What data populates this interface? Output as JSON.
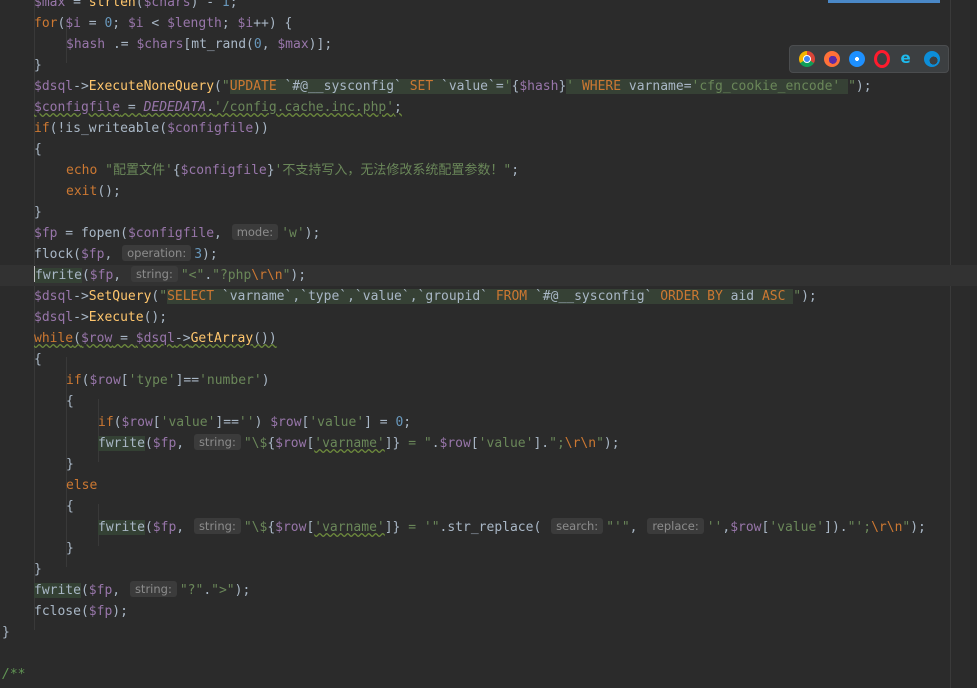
{
  "editor": {
    "lines": [
      {
        "id": "l0",
        "indent": 1,
        "segments": [
          [
            "var",
            "$max"
          ],
          [
            "def",
            " = "
          ],
          [
            "fn",
            "strlen"
          ],
          [
            "def",
            "("
          ],
          [
            "var",
            "$chars"
          ],
          [
            "def",
            ") - "
          ],
          [
            "num",
            "1"
          ],
          [
            "def",
            ";"
          ]
        ]
      },
      {
        "id": "l1",
        "indent": 1,
        "segments": [
          [
            "kw",
            "for"
          ],
          [
            "def",
            "("
          ],
          [
            "var",
            "$i"
          ],
          [
            "def",
            " = "
          ],
          [
            "num",
            "0"
          ],
          [
            "def",
            "; "
          ],
          [
            "var",
            "$i"
          ],
          [
            "def",
            " < "
          ],
          [
            "var",
            "$length"
          ],
          [
            "def",
            "; "
          ],
          [
            "var",
            "$i"
          ],
          [
            "def",
            "++) {"
          ]
        ]
      },
      {
        "id": "l2",
        "indent": 2,
        "segments": [
          [
            "var",
            "$hash"
          ],
          [
            "def",
            " .= "
          ],
          [
            "var",
            "$chars"
          ],
          [
            "def",
            "[mt_rand("
          ],
          [
            "num",
            "0"
          ],
          [
            "def",
            ", "
          ],
          [
            "var",
            "$max"
          ],
          [
            "def",
            ")];"
          ]
        ]
      },
      {
        "id": "l3",
        "indent": 1,
        "segments": [
          [
            "def",
            "}"
          ]
        ]
      },
      {
        "id": "l4",
        "indent": 1,
        "segments": [
          [
            "var",
            "$dsql"
          ],
          [
            "def",
            "->"
          ],
          [
            "fn",
            "ExecuteNoneQuery"
          ],
          [
            "def",
            "("
          ],
          [
            "str",
            "\""
          ],
          [
            "sqlkw",
            "UPDATE"
          ],
          [
            "sqlbgdef",
            " `#@__sysconfig` "
          ],
          [
            "sqlkw",
            "SET"
          ],
          [
            "sqlbgdef",
            " `value`="
          ],
          [
            "sqlbgstr",
            "'"
          ],
          [
            "def",
            "{"
          ],
          [
            "var",
            "$hash"
          ],
          [
            "def",
            "}"
          ],
          [
            "sqlbgstr",
            "' "
          ],
          [
            "sqlkw",
            "WHERE"
          ],
          [
            "sqlbgdef",
            " varname="
          ],
          [
            "sqlbgstr",
            "'cfg_cookie_encode'"
          ],
          [
            "sqlbgdef",
            " "
          ],
          [
            "str",
            "\""
          ],
          [
            "def",
            ");"
          ]
        ]
      },
      {
        "id": "l5",
        "indent": 1,
        "segments": [
          [
            "var",
            "$configfile"
          ],
          [
            "def",
            " = "
          ],
          [
            "const",
            "DEDEDATA"
          ],
          [
            "def",
            "."
          ],
          [
            "str",
            "'/config.cache.inc.php'"
          ],
          [
            "def",
            ";"
          ]
        ],
        "underline": true
      },
      {
        "id": "l6",
        "indent": 1,
        "segments": [
          [
            "kw",
            "if"
          ],
          [
            "def",
            "(!is_writeable("
          ],
          [
            "var",
            "$configfile"
          ],
          [
            "def",
            "))"
          ]
        ]
      },
      {
        "id": "l7",
        "indent": 1,
        "segments": [
          [
            "def",
            "{"
          ]
        ]
      },
      {
        "id": "l8",
        "indent": 2,
        "segments": [
          [
            "kw",
            "echo"
          ],
          [
            "def",
            " "
          ],
          [
            "str",
            "\"配置文件'"
          ],
          [
            "def",
            "{"
          ],
          [
            "var",
            "$configfile"
          ],
          [
            "def",
            "}"
          ],
          [
            "str",
            "'不支持写入，无法修改系统配置参数！\""
          ],
          [
            "def",
            ";"
          ]
        ]
      },
      {
        "id": "l9",
        "indent": 2,
        "segments": [
          [
            "kw",
            "exit"
          ],
          [
            "def",
            "();"
          ]
        ]
      },
      {
        "id": "l10",
        "indent": 1,
        "segments": [
          [
            "def",
            "}"
          ]
        ]
      },
      {
        "id": "l11",
        "indent": 1,
        "segments": [
          [
            "var",
            "$fp"
          ],
          [
            "def",
            " = "
          ],
          [
            "def",
            "fopen("
          ],
          [
            "var",
            "$configfile"
          ],
          [
            "def",
            ", "
          ],
          [
            "hint",
            "mode:"
          ],
          [
            "str",
            "'w'"
          ],
          [
            "def",
            ");"
          ]
        ]
      },
      {
        "id": "l12",
        "indent": 1,
        "segments": [
          [
            "def",
            "flock("
          ],
          [
            "var",
            "$fp"
          ],
          [
            "def",
            ", "
          ],
          [
            "hint",
            "operation:"
          ],
          [
            "num",
            "3"
          ],
          [
            "def",
            ");"
          ]
        ]
      },
      {
        "id": "l13",
        "indent": 1,
        "caret": true,
        "segments": [
          [
            "hlw",
            "fwrite"
          ],
          [
            "def",
            "("
          ],
          [
            "var",
            "$fp"
          ],
          [
            "def",
            ", "
          ],
          [
            "hint",
            "string:"
          ],
          [
            "str",
            "\"<\""
          ],
          [
            "def",
            "."
          ],
          [
            "str",
            "\"?php"
          ],
          [
            "esc",
            "\\r\\n"
          ],
          [
            "str",
            "\""
          ],
          [
            "def",
            ");"
          ]
        ]
      },
      {
        "id": "l14",
        "indent": 1,
        "segments": [
          [
            "var",
            "$dsql"
          ],
          [
            "def",
            "->"
          ],
          [
            "fn",
            "SetQuery"
          ],
          [
            "def",
            "("
          ],
          [
            "str",
            "\""
          ],
          [
            "sqlkw",
            "SELECT"
          ],
          [
            "sqlbgdef",
            " `varname`,`type`,`value`,`groupid` "
          ],
          [
            "sqlkw",
            "FROM"
          ],
          [
            "sqlbgdef",
            " `#@__sysconfig` "
          ],
          [
            "sqlkw",
            "ORDER BY"
          ],
          [
            "sqlbgdef",
            " aid "
          ],
          [
            "sqlkw",
            "ASC"
          ],
          [
            "sqlbgdef",
            " "
          ],
          [
            "str",
            "\""
          ],
          [
            "def",
            ");"
          ]
        ]
      },
      {
        "id": "l15",
        "indent": 1,
        "segments": [
          [
            "var",
            "$dsql"
          ],
          [
            "def",
            "->"
          ],
          [
            "fn",
            "Execute"
          ],
          [
            "def",
            "();"
          ]
        ]
      },
      {
        "id": "l16",
        "indent": 1,
        "segments": [
          [
            "kwu",
            "while"
          ],
          [
            "defu",
            "("
          ],
          [
            "varu",
            "$row"
          ],
          [
            "defu",
            " = "
          ],
          [
            "varu",
            "$dsql"
          ],
          [
            "defu",
            "->"
          ],
          [
            "fnu",
            "GetArray"
          ],
          [
            "defu",
            "())"
          ]
        ]
      },
      {
        "id": "l17",
        "indent": 1,
        "segments": [
          [
            "def",
            "{"
          ]
        ]
      },
      {
        "id": "l18",
        "indent": 2,
        "segments": [
          [
            "kw",
            "if"
          ],
          [
            "def",
            "("
          ],
          [
            "var",
            "$row"
          ],
          [
            "def",
            "["
          ],
          [
            "str",
            "'type'"
          ],
          [
            "def",
            "]=="
          ],
          [
            "str",
            "'number'"
          ],
          [
            "def",
            ")"
          ]
        ]
      },
      {
        "id": "l19",
        "indent": 2,
        "segments": [
          [
            "def",
            "{"
          ]
        ]
      },
      {
        "id": "l20",
        "indent": 3,
        "segments": [
          [
            "kw",
            "if"
          ],
          [
            "def",
            "("
          ],
          [
            "var",
            "$row"
          ],
          [
            "def",
            "["
          ],
          [
            "str",
            "'value'"
          ],
          [
            "def",
            "]=="
          ],
          [
            "str",
            "''"
          ],
          [
            "def",
            ") "
          ],
          [
            "var",
            "$row"
          ],
          [
            "def",
            "["
          ],
          [
            "str",
            "'value'"
          ],
          [
            "def",
            "] = "
          ],
          [
            "num",
            "0"
          ],
          [
            "def",
            ";"
          ]
        ]
      },
      {
        "id": "l21",
        "indent": 3,
        "segments": [
          [
            "hlw",
            "fwrite"
          ],
          [
            "def",
            "("
          ],
          [
            "var",
            "$fp"
          ],
          [
            "def",
            ", "
          ],
          [
            "hint",
            "string:"
          ],
          [
            "str",
            "\"\\$"
          ],
          [
            "def",
            "{"
          ],
          [
            "var",
            "$row"
          ],
          [
            "def",
            "["
          ],
          [
            "stru",
            "'varname'"
          ],
          [
            "def",
            "]}"
          ],
          [
            "str",
            " = \""
          ],
          [
            "def",
            "."
          ],
          [
            "var",
            "$row"
          ],
          [
            "def",
            "["
          ],
          [
            "str",
            "'value'"
          ],
          [
            "def",
            "]."
          ],
          [
            "str",
            "\";"
          ],
          [
            "esc",
            "\\r\\n"
          ],
          [
            "str",
            "\""
          ],
          [
            "def",
            ");"
          ]
        ]
      },
      {
        "id": "l22",
        "indent": 2,
        "segments": [
          [
            "def",
            "}"
          ]
        ]
      },
      {
        "id": "l23",
        "indent": 2,
        "segments": [
          [
            "kw",
            "else"
          ]
        ]
      },
      {
        "id": "l24",
        "indent": 2,
        "segments": [
          [
            "def",
            "{"
          ]
        ]
      },
      {
        "id": "l25",
        "indent": 3,
        "segments": [
          [
            "hlw",
            "fwrite"
          ],
          [
            "def",
            "("
          ],
          [
            "var",
            "$fp"
          ],
          [
            "def",
            ", "
          ],
          [
            "hint",
            "string:"
          ],
          [
            "str",
            "\"\\$"
          ],
          [
            "def",
            "{"
          ],
          [
            "var",
            "$row"
          ],
          [
            "def",
            "["
          ],
          [
            "stru",
            "'varname'"
          ],
          [
            "def",
            "]}"
          ],
          [
            "str",
            " = '\""
          ],
          [
            "def",
            ".str_replace( "
          ],
          [
            "hint",
            "search:"
          ],
          [
            "str",
            "\"'\""
          ],
          [
            "def",
            ", "
          ],
          [
            "hint",
            "replace:"
          ],
          [
            "str",
            "''"
          ],
          [
            "def",
            ","
          ],
          [
            "var",
            "$row"
          ],
          [
            "def",
            "["
          ],
          [
            "str",
            "'value'"
          ],
          [
            "def",
            "])."
          ],
          [
            "str",
            "\"';"
          ],
          [
            "esc",
            "\\r\\n"
          ],
          [
            "str",
            "\""
          ],
          [
            "def",
            ");"
          ]
        ]
      },
      {
        "id": "l26",
        "indent": 2,
        "segments": [
          [
            "def",
            "}"
          ]
        ]
      },
      {
        "id": "l27",
        "indent": 1,
        "segments": [
          [
            "def",
            "}"
          ]
        ]
      },
      {
        "id": "l28",
        "indent": 1,
        "segments": [
          [
            "hlw",
            "fwrite"
          ],
          [
            "def",
            "("
          ],
          [
            "var",
            "$fp"
          ],
          [
            "def",
            ", "
          ],
          [
            "hint",
            "string:"
          ],
          [
            "str",
            "\"?\""
          ],
          [
            "def",
            "."
          ],
          [
            "str",
            "\">\""
          ],
          [
            "def",
            ");"
          ]
        ]
      },
      {
        "id": "l29",
        "indent": 1,
        "segments": [
          [
            "def",
            "fclose("
          ],
          [
            "var",
            "$fp"
          ],
          [
            "def",
            ");"
          ]
        ]
      },
      {
        "id": "l30",
        "indent": 0,
        "segments": [
          [
            "def",
            "}"
          ]
        ]
      },
      {
        "id": "l31",
        "indent": 0,
        "segments": [
          [
            "def",
            ""
          ]
        ]
      },
      {
        "id": "l32",
        "indent": 0,
        "segments": [
          [
            "cmt",
            "/**"
          ]
        ]
      }
    ]
  },
  "browser_bar": {
    "icons": [
      "chrome-icon",
      "firefox-icon",
      "safari-icon",
      "opera-icon",
      "ie-icon",
      "edge-icon"
    ],
    "colors": {
      "chrome": "#4285f4",
      "firefox": "#ff7139",
      "safari": "#1e90ff",
      "opera": "#ff1b2d",
      "ie": "#1ebbee",
      "edge": "#0c8ed9"
    }
  },
  "theme": {
    "background": "#2b2b2b",
    "keyword": "#cc7832",
    "variable": "#9876aa",
    "function": "#ffc66d",
    "string": "#6a8759",
    "number": "#6897bb"
  }
}
